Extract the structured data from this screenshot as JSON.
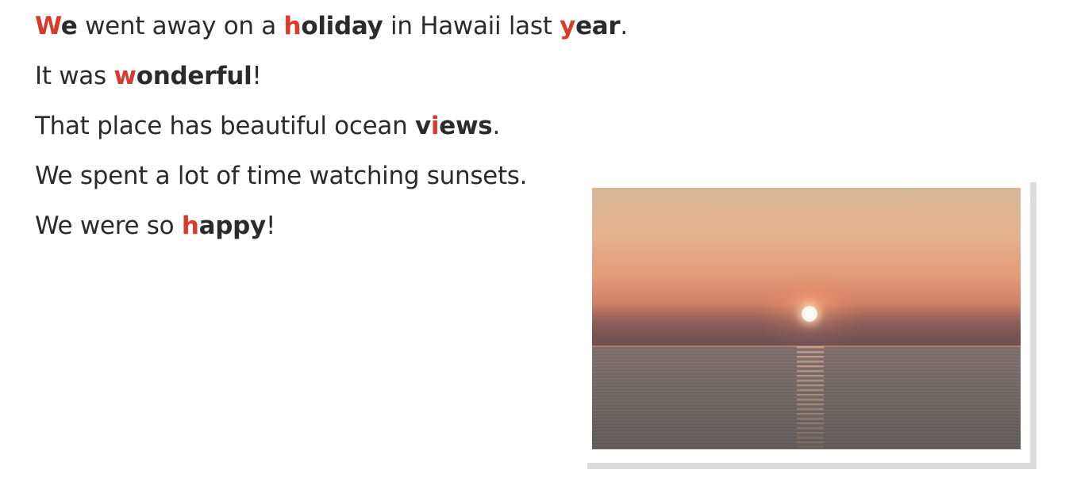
{
  "sentences": [
    {
      "parts": [
        {
          "text": "W",
          "style": "hl"
        },
        {
          "text": "e",
          "style": "kw"
        },
        {
          "text": " went away on a ",
          "style": "plain"
        },
        {
          "text": "h",
          "style": "hl"
        },
        {
          "text": "oliday",
          "style": "kw"
        },
        {
          "text": " in Hawaii last ",
          "style": "plain"
        },
        {
          "text": "y",
          "style": "hl"
        },
        {
          "text": "ear",
          "style": "kw"
        },
        {
          "text": ".",
          "style": "plain"
        }
      ]
    },
    {
      "parts": [
        {
          "text": "It was ",
          "style": "plain"
        },
        {
          "text": "w",
          "style": "hl"
        },
        {
          "text": "onderful",
          "style": "kw"
        },
        {
          "text": "!",
          "style": "plain"
        }
      ]
    },
    {
      "parts": [
        {
          "text": "That place has beautiful ocean ",
          "style": "plain"
        },
        {
          "text": "v",
          "style": "kw"
        },
        {
          "text": "i",
          "style": "hl"
        },
        {
          "text": "ews",
          "style": "kw"
        },
        {
          "text": ".",
          "style": "plain"
        }
      ]
    },
    {
      "parts": [
        {
          "text": "We spent a lot of time watching sunsets.",
          "style": "plain"
        }
      ]
    },
    {
      "parts": [
        {
          "text": "We were so ",
          "style": "plain"
        },
        {
          "text": "h",
          "style": "hl"
        },
        {
          "text": "appy",
          "style": "kw"
        },
        {
          "text": "!",
          "style": "plain"
        }
      ]
    }
  ],
  "colors": {
    "highlight": "#d93a2b",
    "text": "#2b2b2b"
  },
  "photo": {
    "subject": "sunset-over-ocean-photo"
  }
}
